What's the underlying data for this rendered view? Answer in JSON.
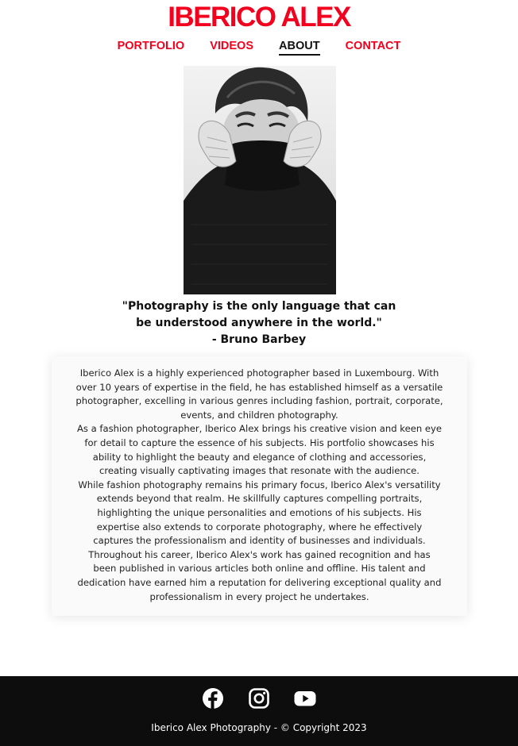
{
  "header": {
    "site_title": "IBERICO ALEX",
    "nav": [
      {
        "label": "PORTFOLIO"
      },
      {
        "label": "VIDEOS"
      },
      {
        "label": "ABOUT"
      },
      {
        "label": "CONTACT"
      }
    ],
    "active_nav": "ABOUT"
  },
  "hero": {
    "alt": "Black and white portrait of a man pulling up his turtleneck over his face"
  },
  "quote": {
    "text": "\"Photography is the only language that can be understood anywhere in the world.\"",
    "author": "- Bruno Barbey"
  },
  "bio": {
    "paragraphs": [
      "Iberico Alex is a highly experienced photographer based in Luxembourg. With over 10 years of expertise in the field, he has established himself as a versatile photographer, excelling in various genres including fashion, portrait, corporate, events, and children photography.",
      "As a fashion photographer, Iberico Alex brings his creative vision and keen eye for detail to capture the essence of his subjects. His portfolio showcases his ability to highlight the beauty and elegance of clothing and accessories, creating visually captivating images that resonate with the audience.",
      "While fashion photography remains his primary focus, Iberico Alex's versatility extends beyond that realm. He skillfully captures compelling portraits, highlighting the unique personalities and emotions of his subjects. His expertise also extends to corporate photography, where he effectively captures the professionalism and identity of businesses and individuals.",
      "Throughout his career, Iberico Alex's work has gained recognition and has been published in various articles both online and offline. His talent and dedication have earned him a reputation for delivering exceptional quality and professionalism in every project he undertakes."
    ]
  },
  "footer": {
    "social": [
      "facebook-icon",
      "instagram-icon",
      "youtube-icon"
    ],
    "copyright": "Iberico Alex Photography - © Copyright 2023"
  },
  "colors": {
    "brand_red": "#f2001d",
    "footer_bg": "#0d0d0d"
  }
}
